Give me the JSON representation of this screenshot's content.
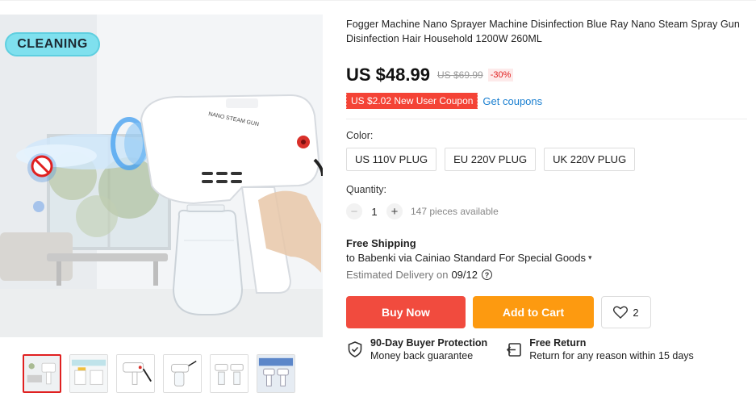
{
  "gallery": {
    "badge": "CLEANING",
    "device_label": "NANO STEAM GUN",
    "thumbnails": [
      "thumb-1",
      "thumb-2",
      "thumb-3",
      "thumb-4",
      "thumb-5",
      "thumb-6"
    ]
  },
  "product": {
    "title": "Fogger Machine Nano Sprayer Machine Disinfection Blue Ray Nano Steam Spray Gun Disinfection Hair Household 1200W 260ML",
    "price": "US $48.99",
    "old_price": "US $69.99",
    "discount": "-30%",
    "coupon": "US $2.02 New User Coupon",
    "get_coupons": "Get coupons"
  },
  "options": {
    "label": "Color:",
    "items": [
      "US 110V PLUG",
      "EU 220V PLUG",
      "UK 220V PLUG"
    ]
  },
  "quantity": {
    "label": "Quantity:",
    "value": "1",
    "minus": "−",
    "plus": "+",
    "available": "147 pieces available"
  },
  "shipping": {
    "title": "Free Shipping",
    "to": "to Babenki via Cainiao Standard For Special Goods",
    "estimated_label": "Estimated Delivery on",
    "date": "09/12",
    "help": "?"
  },
  "actions": {
    "buy_now": "Buy Now",
    "add_to_cart": "Add to Cart",
    "wish_count": "2"
  },
  "guarantees": [
    {
      "title": "90-Day Buyer Protection",
      "subtitle": "Money back guarantee"
    },
    {
      "title": "Free Return",
      "subtitle": "Return for any reason within 15 days"
    }
  ],
  "colors": {
    "buy": "#f14b3e",
    "cart": "#fd9a10",
    "coupon": "#f44336",
    "link": "#1a7fd0"
  }
}
